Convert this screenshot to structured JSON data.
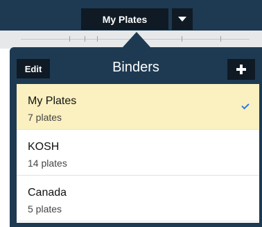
{
  "topbar": {
    "current_binder": "My Plates"
  },
  "popover": {
    "edit_label": "Edit",
    "title": "Binders",
    "add_icon": "plus-icon"
  },
  "binders": [
    {
      "name": "My Plates",
      "count": "7 plates",
      "selected": true
    },
    {
      "name": "KOSH",
      "count": "14 plates",
      "selected": false
    },
    {
      "name": "Canada",
      "count": "5 plates",
      "selected": false
    }
  ],
  "colors": {
    "nav": "#1e3a52",
    "button": "#0f1a24",
    "selected_row": "#faf0c0",
    "check": "#2d7be0"
  }
}
